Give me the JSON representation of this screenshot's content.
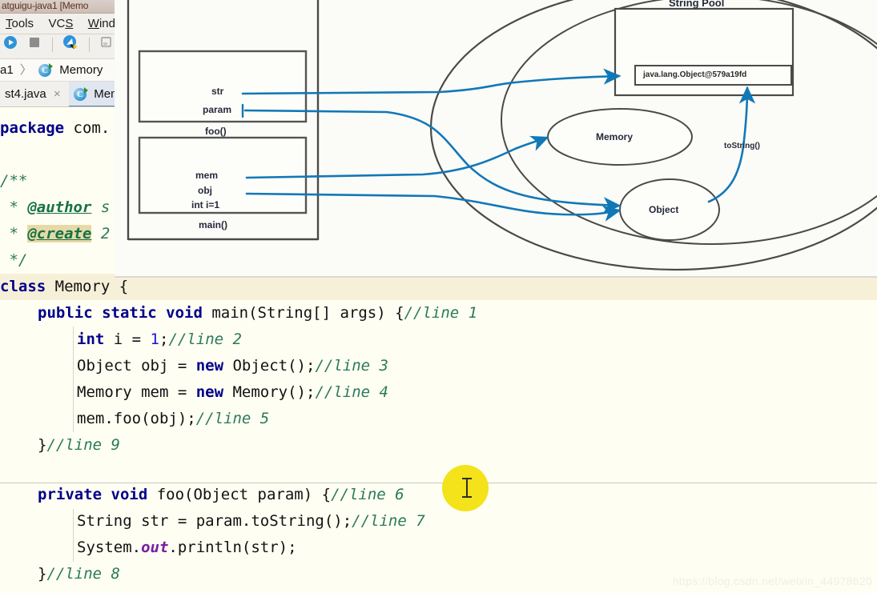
{
  "window": {
    "title": "atguigu-java1 [Memo",
    "menus": [
      {
        "label": "Tools",
        "accel": "T"
      },
      {
        "label": "VCS",
        "accel": "S"
      },
      {
        "label": "Windo",
        "accel": "W"
      }
    ],
    "toolbar_icons": [
      "run-icon",
      "stop-icon",
      "separator",
      "inspect-icon",
      "separator",
      "bookmark-icon",
      "structure-icon"
    ],
    "breadcrumb": {
      "project": "a1",
      "separator": "〉",
      "class_icon": "java-class-icon",
      "class_name": "Memory"
    },
    "tabs": [
      {
        "label": "st4.java",
        "icon": "",
        "close": "×",
        "active": false
      },
      {
        "label": "Mem",
        "icon": "java-class-icon",
        "close": "",
        "active": true
      }
    ]
  },
  "editor": {
    "lines": [
      {
        "id": "package",
        "indent": 0,
        "segments": [
          {
            "t": "package",
            "c": "kw"
          },
          {
            "t": " com.",
            "c": "plain"
          }
        ]
      },
      {
        "id": "blank1",
        "indent": 0,
        "segments": []
      },
      {
        "id": "doc-open",
        "indent": 0,
        "segments": [
          {
            "t": "/**",
            "c": "cmt"
          }
        ]
      },
      {
        "id": "doc-author",
        "indent": 0,
        "segments": [
          {
            "t": " * ",
            "c": "cmt"
          },
          {
            "t": "@author",
            "c": "anno"
          },
          {
            "t": " s",
            "c": "cmt"
          }
        ]
      },
      {
        "id": "doc-create",
        "indent": 0,
        "segments": [
          {
            "t": " * ",
            "c": "cmt"
          },
          {
            "t": "@create",
            "c": "anno annohl"
          },
          {
            "t": " 2",
            "c": "cmt"
          }
        ]
      },
      {
        "id": "doc-close",
        "indent": 0,
        "segments": [
          {
            "t": " */",
            "c": "cmt"
          }
        ]
      },
      {
        "id": "class-decl",
        "indent": 0,
        "highlight": true,
        "segments": [
          {
            "t": "class",
            "c": "kw"
          },
          {
            "t": " Memory ",
            "c": "plain"
          },
          {
            "t": "{",
            "c": "plain"
          }
        ]
      },
      {
        "id": "main-decl",
        "indent": 1,
        "segments": [
          {
            "t": "public static void",
            "c": "kw"
          },
          {
            "t": " main(String[] args) {",
            "c": "plain"
          },
          {
            "t": "//line 1",
            "c": "cmt"
          }
        ]
      },
      {
        "id": "line2",
        "indent": 2,
        "segments": [
          {
            "t": "int",
            "c": "kw"
          },
          {
            "t": " i = ",
            "c": "plain"
          },
          {
            "t": "1",
            "c": "num"
          },
          {
            "t": ";",
            "c": "plain"
          },
          {
            "t": "//line 2",
            "c": "cmt"
          }
        ]
      },
      {
        "id": "line3",
        "indent": 2,
        "segments": [
          {
            "t": "Object obj = ",
            "c": "plain"
          },
          {
            "t": "new",
            "c": "kw"
          },
          {
            "t": " Object();",
            "c": "plain"
          },
          {
            "t": "//line 3",
            "c": "cmt"
          }
        ]
      },
      {
        "id": "line4",
        "indent": 2,
        "segments": [
          {
            "t": "Memory mem = ",
            "c": "plain"
          },
          {
            "t": "new",
            "c": "kw"
          },
          {
            "t": " Memory();",
            "c": "plain"
          },
          {
            "t": "//line 4",
            "c": "cmt"
          }
        ]
      },
      {
        "id": "line5",
        "indent": 2,
        "segments": [
          {
            "t": "mem.foo(obj);",
            "c": "plain"
          },
          {
            "t": "//line 5",
            "c": "cmt"
          }
        ]
      },
      {
        "id": "line9",
        "indent": 1,
        "segments": [
          {
            "t": "}",
            "c": "plain"
          },
          {
            "t": "//line 9",
            "c": "cmt"
          }
        ]
      },
      {
        "id": "foo-decl",
        "indent": 1,
        "segments": [
          {
            "t": "private void",
            "c": "kw"
          },
          {
            "t": " foo(Object param) {",
            "c": "plain"
          },
          {
            "t": "//line 6",
            "c": "cmt"
          }
        ]
      },
      {
        "id": "line7",
        "indent": 2,
        "segments": [
          {
            "t": "String str = param.toString();",
            "c": "plain"
          },
          {
            "t": "//line 7",
            "c": "cmt"
          }
        ]
      },
      {
        "id": "println",
        "indent": 2,
        "segments": [
          {
            "t": "System.",
            "c": "plain"
          },
          {
            "t": "out",
            "c": "fieldst"
          },
          {
            "t": ".println(str);",
            "c": "plain"
          }
        ]
      },
      {
        "id": "line8",
        "indent": 1,
        "segments": [
          {
            "t": "}",
            "c": "plain"
          },
          {
            "t": "//line 8",
            "c": "cmt"
          }
        ]
      }
    ],
    "caret_icon": "text-cursor-icon"
  },
  "diagram": {
    "type": "jvm-memory-diagram",
    "stack": {
      "container_label": "",
      "frames": [
        {
          "name": "foo-frame",
          "caption": "foo()",
          "vars": [
            "str",
            "param"
          ]
        },
        {
          "name": "main-frame",
          "caption": "main()",
          "vars": [
            "mem",
            "obj",
            "int i=1"
          ]
        }
      ]
    },
    "heap": {
      "label": "",
      "string_pool": {
        "title": "String Pool",
        "entry": "java.lang.Object@579a19fd"
      },
      "objects": [
        {
          "name": "memory-object",
          "label": "Memory"
        },
        {
          "name": "object-object",
          "label": "Object"
        }
      ],
      "edge_label": "toString()"
    },
    "arrow_color": "#1178b8",
    "outline_color": "#4a4a4a"
  },
  "watermark": "https://blog.csdn.net/weixin_44978620"
}
